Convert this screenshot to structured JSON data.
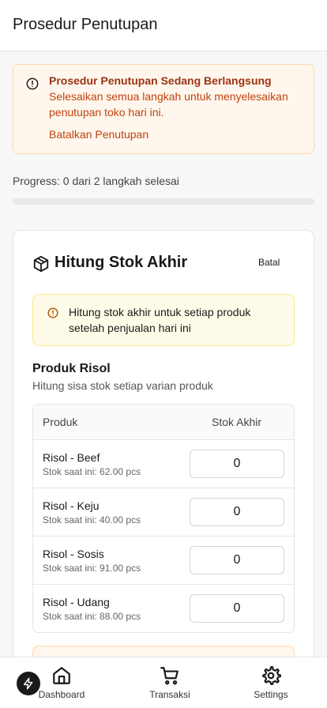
{
  "header": {
    "title": "Prosedur Penutupan"
  },
  "alert": {
    "icon": "alert-circle-icon",
    "title": "Prosedur Penutupan Sedang Berlangsung",
    "message": "Selesaikan semua langkah untuk menyelesaikan penutupan toko hari ini.",
    "link": "Batalkan Penutupan"
  },
  "progress": {
    "text": "Progress: 0 dari 2 langkah selesai",
    "completed": 0,
    "total": 2
  },
  "card": {
    "icon": "package-icon",
    "title": "Hitung Stok Akhir",
    "cancel_label": "Batal",
    "info": "Hitung stok akhir untuk setiap produk setelah penjualan hari ini",
    "section_title": "Produk Risol",
    "section_subtitle": "Hitung sisa stok setiap varian produk",
    "table": {
      "col_product": "Produk",
      "col_stock": "Stok Akhir",
      "rows": [
        {
          "name": "Risol - Beef",
          "stock": "Stok saat ini: 62.00 pcs",
          "value": "0"
        },
        {
          "name": "Risol - Keju",
          "stock": "Stok saat ini: 40.00 pcs",
          "value": "0"
        },
        {
          "name": "Risol - Sosis",
          "stock": "Stok saat ini: 91.00 pcs",
          "value": "0"
        },
        {
          "name": "Risol - Udang",
          "stock": "Stok saat ini: 88.00 pcs",
          "value": "0"
        }
      ]
    }
  },
  "nav": {
    "dashboard": "Dashboard",
    "transaksi": "Transaksi",
    "settings": "Settings"
  },
  "colors": {
    "accent": "#1a1a1a",
    "alert_bg": "#fff7ed",
    "alert_text": "#c2410c",
    "info_bg": "#fefce8"
  }
}
